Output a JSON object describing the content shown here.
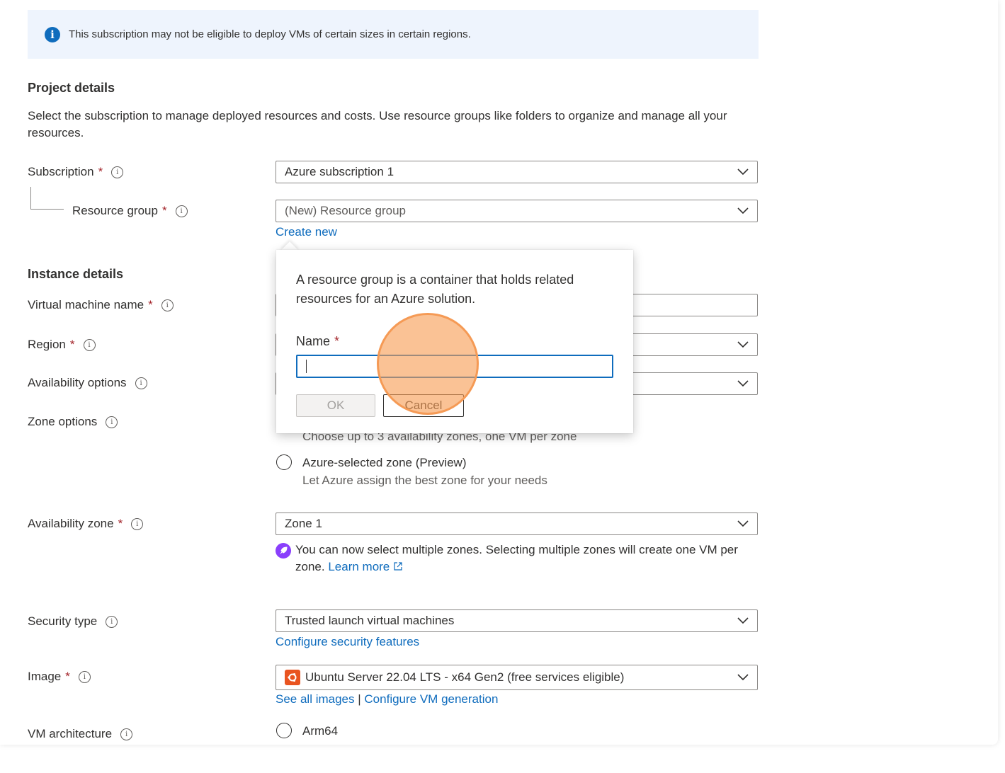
{
  "banner": {
    "icon": "info-icon",
    "text": "This subscription may not be eligible to deploy VMs of certain sizes in certain regions."
  },
  "project": {
    "title": "Project details",
    "description": "Select the subscription to manage deployed resources and costs. Use resource groups like folders to organize and manage all your resources.",
    "subscription": {
      "label": "Subscription",
      "required": "*",
      "value": "Azure subscription 1"
    },
    "resource_group": {
      "label": "Resource group",
      "required": "*",
      "value": "(New) Resource group",
      "create_link": "Create new"
    }
  },
  "instance": {
    "title": "Instance details",
    "vm_name_label": "Virtual machine name",
    "region_label": "Region",
    "availability_options_label": "Availability options",
    "zone_options_label": "Zone options",
    "zone_options": {
      "self_selected_hint": "Choose up to 3 availability zones, one VM per zone",
      "azure_selected_label": "Azure-selected zone (Preview)",
      "azure_selected_hint": "Let Azure assign the best zone for your needs"
    },
    "availability_zone": {
      "label": "Availability zone",
      "value": "Zone 1",
      "note": "You can now select multiple zones. Selecting multiple zones will create one VM per zone.",
      "learn_more": "Learn more"
    },
    "security_type": {
      "label": "Security type",
      "value": "Trusted launch virtual machines",
      "link": "Configure security features"
    },
    "image": {
      "label": "Image",
      "value": "Ubuntu Server 22.04 LTS - x64 Gen2 (free services eligible)",
      "link1": "See all images",
      "separator": "|",
      "link2": "Configure VM generation"
    },
    "vm_architecture": {
      "label": "VM architecture",
      "option": "Arm64"
    }
  },
  "required_marker": "*",
  "info_glyph": "i",
  "callout": {
    "description": "A resource group is a container that holds related resources for an Azure solution.",
    "name_label": "Name",
    "name_value": "",
    "ok_label": "OK",
    "cancel_label": "Cancel"
  },
  "colors": {
    "accent": "#0f6cbd",
    "required": "#a4262c",
    "click_marker": "#f59a55",
    "banner_bg": "#eef4fd"
  }
}
